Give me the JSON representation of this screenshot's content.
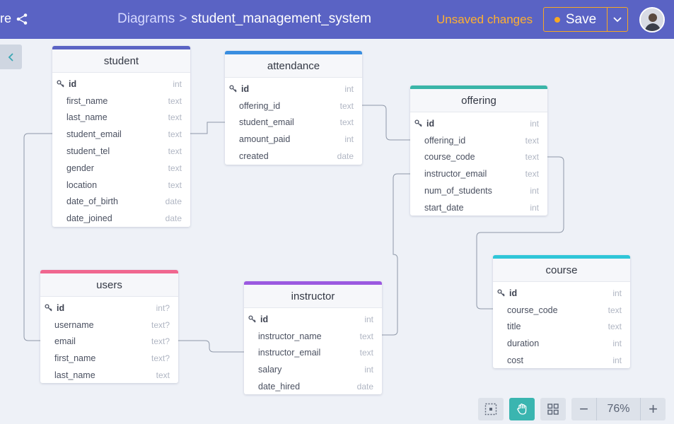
{
  "header": {
    "share_label": "re",
    "breadcrumb_root": "Diagrams",
    "breadcrumb_sep": ">",
    "breadcrumb_current": "student_management_system",
    "status": "Unsaved changes",
    "save_label": "Save"
  },
  "colors": {
    "header_bg": "#5a63c4",
    "accent_orange": "#f7a823",
    "student": "#5a63c4",
    "attendance": "#3a8ee0",
    "offering": "#3ab5a8",
    "course": "#2fc6d8",
    "users": "#f0678f",
    "instructor": "#9b59e0"
  },
  "tables": {
    "student": {
      "title": "student",
      "rows": [
        {
          "name": "id",
          "type": "int"
        },
        {
          "name": "first_name",
          "type": "text"
        },
        {
          "name": "last_name",
          "type": "text"
        },
        {
          "name": "student_email",
          "type": "text"
        },
        {
          "name": "student_tel",
          "type": "text"
        },
        {
          "name": "gender",
          "type": "text"
        },
        {
          "name": "location",
          "type": "text"
        },
        {
          "name": "date_of_birth",
          "type": "date"
        },
        {
          "name": "date_joined",
          "type": "date"
        }
      ]
    },
    "attendance": {
      "title": "attendance",
      "rows": [
        {
          "name": "id",
          "type": "int"
        },
        {
          "name": "offering_id",
          "type": "text"
        },
        {
          "name": "student_email",
          "type": "text"
        },
        {
          "name": "amount_paid",
          "type": "int"
        },
        {
          "name": "created",
          "type": "date"
        }
      ]
    },
    "offering": {
      "title": "offering",
      "rows": [
        {
          "name": "id",
          "type": "int"
        },
        {
          "name": "offering_id",
          "type": "text"
        },
        {
          "name": "course_code",
          "type": "text"
        },
        {
          "name": "instructor_email",
          "type": "text"
        },
        {
          "name": "num_of_students",
          "type": "int"
        },
        {
          "name": "start_date",
          "type": "int"
        }
      ]
    },
    "users": {
      "title": "users",
      "rows": [
        {
          "name": "id",
          "type": "int?"
        },
        {
          "name": "username",
          "type": "text?"
        },
        {
          "name": "email",
          "type": "text?"
        },
        {
          "name": "first_name",
          "type": "text?"
        },
        {
          "name": "last_name",
          "type": "text"
        }
      ]
    },
    "instructor": {
      "title": "instructor",
      "rows": [
        {
          "name": "id",
          "type": "int"
        },
        {
          "name": "instructor_name",
          "type": "text"
        },
        {
          "name": "instructor_email",
          "type": "text"
        },
        {
          "name": "salary",
          "type": "int"
        },
        {
          "name": "date_hired",
          "type": "date"
        }
      ]
    },
    "course": {
      "title": "course",
      "rows": [
        {
          "name": "id",
          "type": "int"
        },
        {
          "name": "course_code",
          "type": "text"
        },
        {
          "name": "title",
          "type": "text"
        },
        {
          "name": "duration",
          "type": "int"
        },
        {
          "name": "cost",
          "type": "int"
        }
      ]
    }
  },
  "toolbar": {
    "zoom_level": "76%",
    "zoom_out": "−",
    "zoom_in": "+",
    "icons": [
      "grid-snap-icon",
      "hand-pan-icon",
      "layout-grid-icon"
    ]
  }
}
